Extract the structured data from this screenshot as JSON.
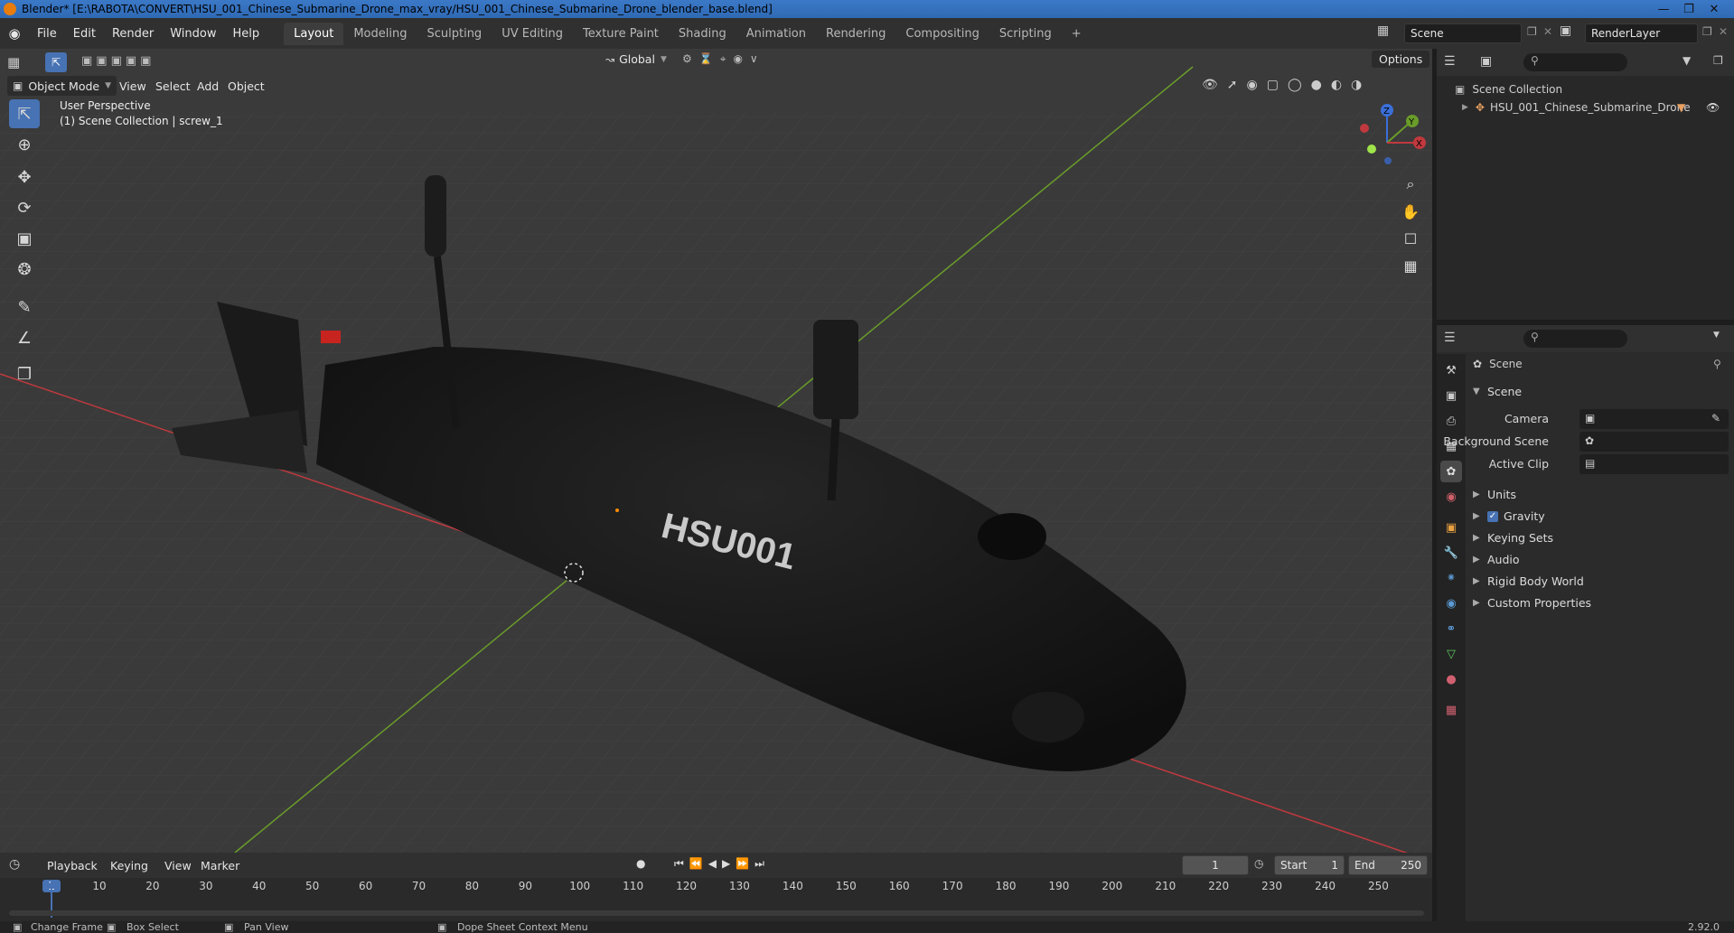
{
  "window": {
    "title": "Blender* [E:\\RABOTA\\CONVERT\\HSU_001_Chinese_Submarine_Drone_max_vray/HSU_001_Chinese_Submarine_Drone_blender_base.blend]"
  },
  "menu": [
    "File",
    "Edit",
    "Render",
    "Window",
    "Help"
  ],
  "workspaces": [
    "Layout",
    "Modeling",
    "Sculpting",
    "UV Editing",
    "Texture Paint",
    "Shading",
    "Animation",
    "Rendering",
    "Compositing",
    "Scripting"
  ],
  "workspace_add": "+",
  "scene": {
    "name": "Scene",
    "render_layer": "RenderLayer"
  },
  "viewport": {
    "mode": "Object Mode",
    "menus": [
      "View",
      "Select",
      "Add",
      "Object"
    ],
    "orientation": "Global",
    "options": "Options",
    "perspective": "User Perspective",
    "collection_info": "(1) Scene Collection | screw_1",
    "model_label": "HSU001",
    "gizmo": {
      "z": "Z",
      "y": "Y",
      "x": "X"
    }
  },
  "outliner": {
    "root": "Scene Collection",
    "items": [
      "HSU_001_Chinese_Submarine_Drone"
    ]
  },
  "properties": {
    "context": "Scene",
    "section": "Scene",
    "fields": [
      {
        "label": "Camera"
      },
      {
        "label": "Background Scene"
      },
      {
        "label": "Active Clip"
      }
    ],
    "panels": [
      "Units",
      "Gravity",
      "Keying Sets",
      "Audio",
      "Rigid Body World",
      "Custom Properties"
    ],
    "gravity_checked": true
  },
  "timeline": {
    "menus": [
      "Playback",
      "Keying",
      "View",
      "Marker"
    ],
    "current_frame": "1",
    "start_label": "Start",
    "start": "1",
    "end_label": "End",
    "end": "250",
    "ticks": [
      "1",
      "10",
      "20",
      "30",
      "40",
      "50",
      "60",
      "70",
      "80",
      "90",
      "100",
      "110",
      "120",
      "130",
      "140",
      "150",
      "160",
      "170",
      "180",
      "190",
      "200",
      "210",
      "220",
      "230",
      "240",
      "250"
    ]
  },
  "status": {
    "items": [
      "Change Frame",
      "Box Select",
      "Pan View",
      "Dope Sheet Context Menu"
    ],
    "version": "2.92.0"
  },
  "colors": {
    "accent": "#4772b3",
    "x_axis": "#c0393e",
    "y_axis": "#6a9c2a",
    "hull": "#141414"
  }
}
